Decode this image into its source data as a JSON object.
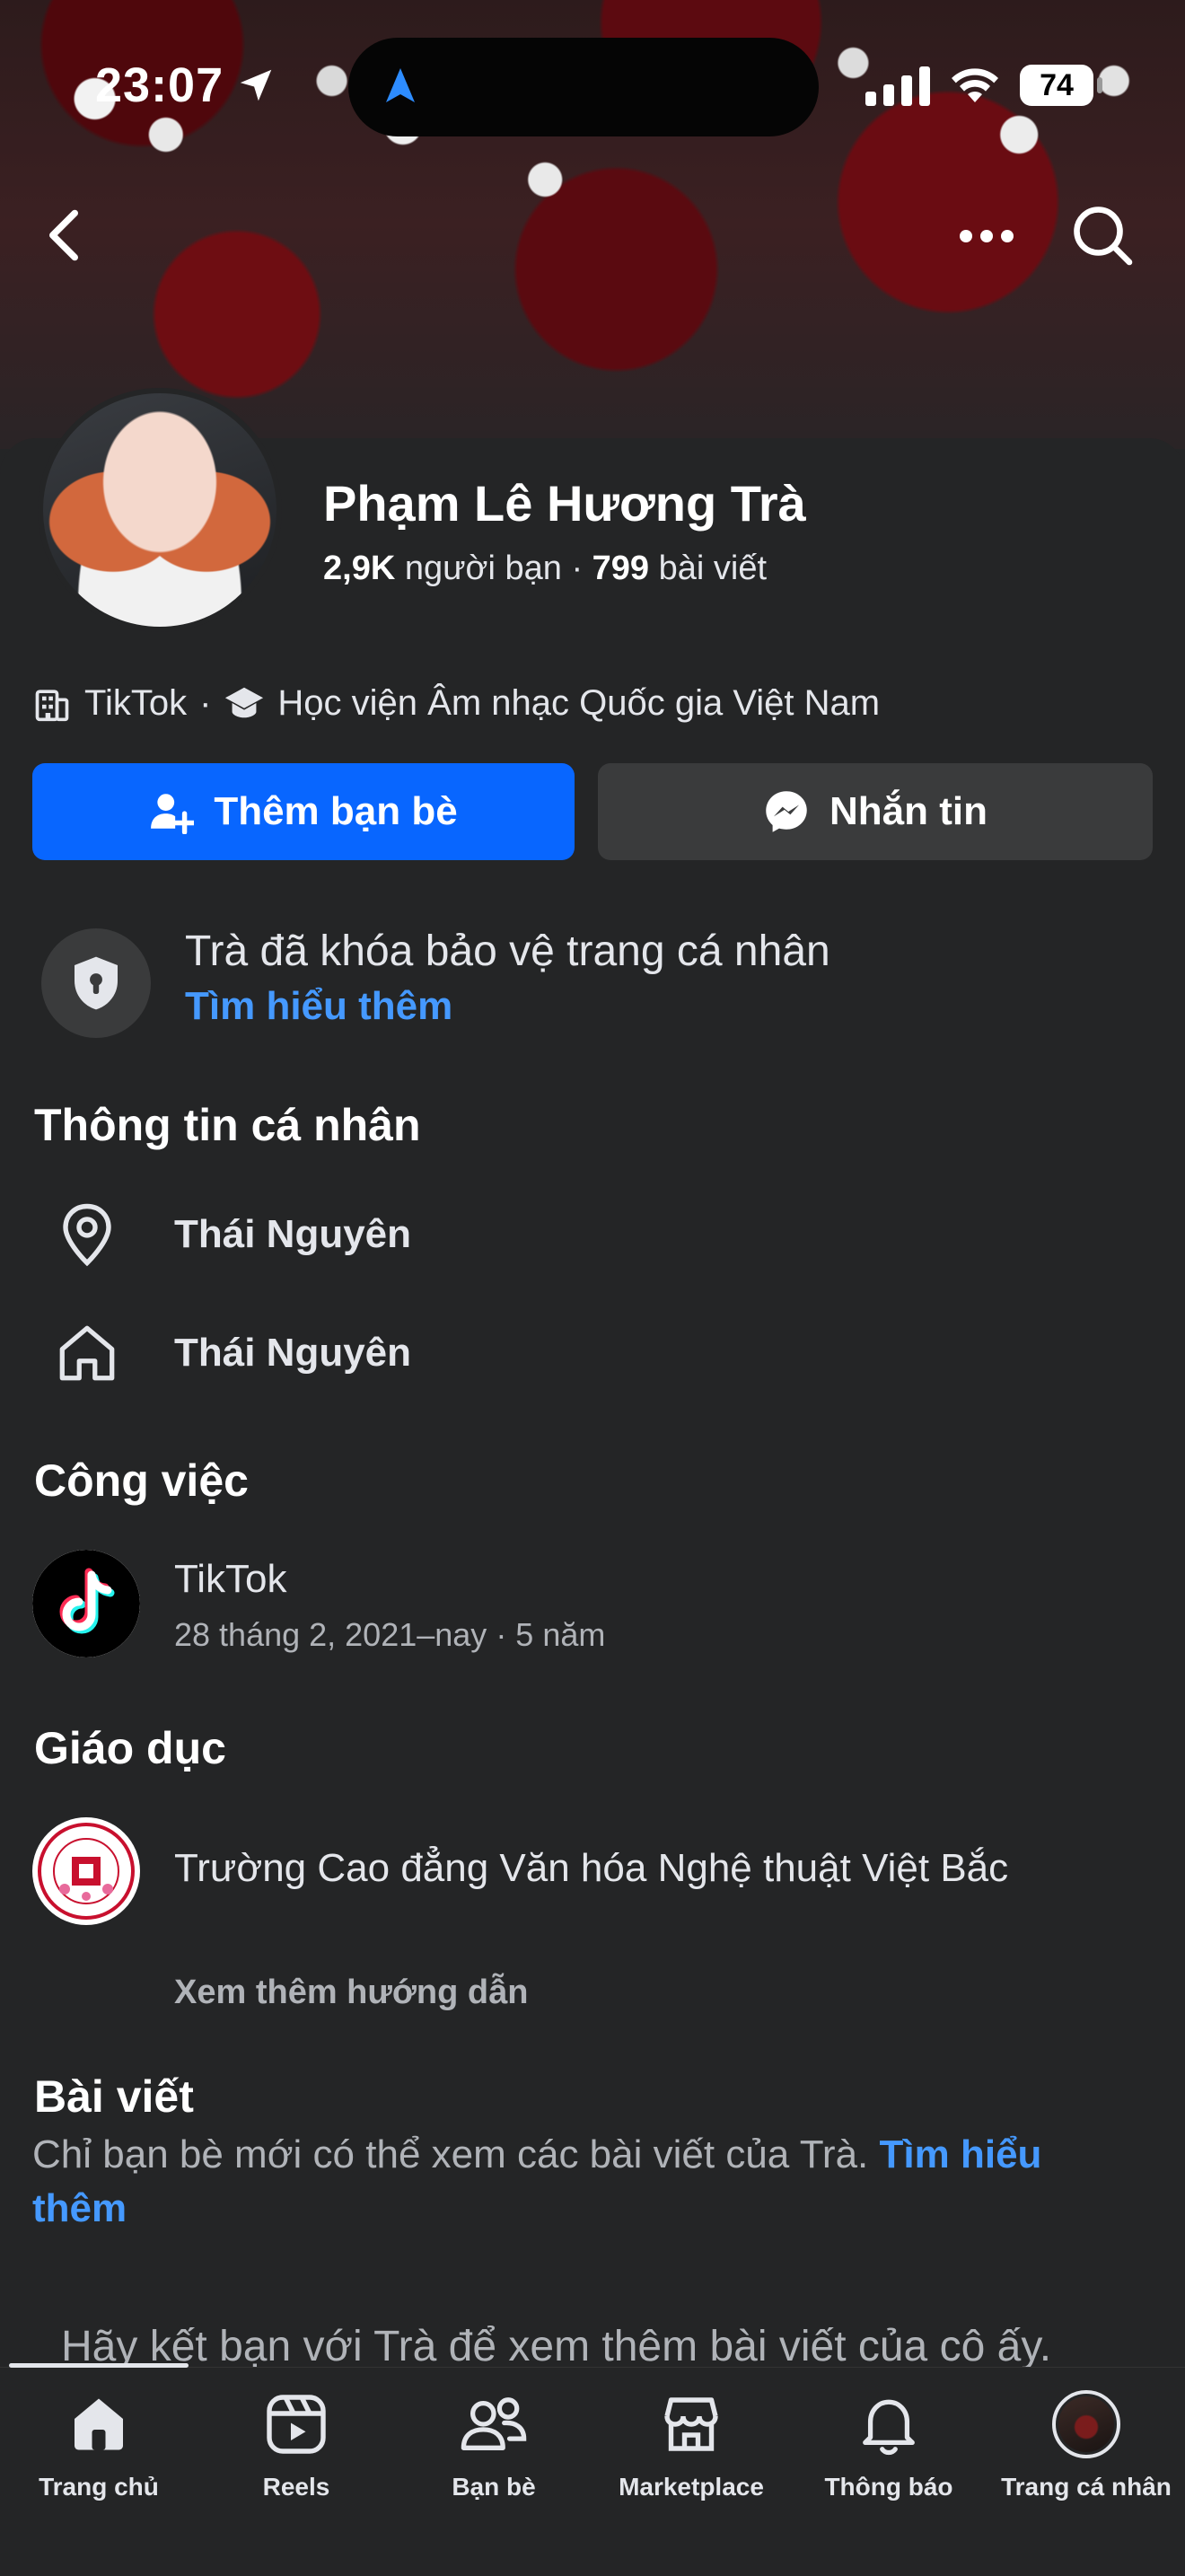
{
  "status_bar": {
    "time": "23:07",
    "battery": "74"
  },
  "profile": {
    "name": "Phạm Lê Hương Trà",
    "friends_count": "2,9K",
    "friends_label": "người bạn",
    "posts_count": "799",
    "posts_label": "bài viết",
    "work_short": "TikTok",
    "school_short": "Học viện Âm nhạc Quốc gia Việt Nam"
  },
  "actions": {
    "add_friend": "Thêm bạn bè",
    "message": "Nhắn tin"
  },
  "lock_notice": {
    "text": "Trà đã khóa bảo vệ trang cá nhân",
    "link": "Tìm hiểu thêm"
  },
  "personal_info": {
    "title": "Thông tin cá nhân",
    "current_city": "Thái Nguyên",
    "hometown": "Thái Nguyên"
  },
  "work": {
    "title": "Công việc",
    "company": "TikTok",
    "period": "28 tháng 2, 2021–nay · 5 năm"
  },
  "education": {
    "title": "Giáo dục",
    "school": "Trường Cao đẳng Văn hóa Nghệ thuật Việt Bắc",
    "see_more": "Xem thêm hướng dẫn"
  },
  "posts": {
    "title": "Bài viết",
    "desc": "Chỉ bạn bè mới có thể xem các bài viết của Trà.",
    "link": "Tìm hiểu thêm",
    "hint": "Hãy kết bạn với Trà để xem thêm bài viết của cô ấy."
  },
  "tabs": [
    {
      "label": "Trang chủ",
      "icon": "home-icon"
    },
    {
      "label": "Reels",
      "icon": "reels-icon"
    },
    {
      "label": "Bạn bè",
      "icon": "friends-icon"
    },
    {
      "label": "Marketplace",
      "icon": "marketplace-icon"
    },
    {
      "label": "Thông báo",
      "icon": "bell-icon"
    },
    {
      "label": "Trang cá nhân",
      "icon": "profile-avatar-icon"
    }
  ],
  "colors": {
    "background": "#242526",
    "primary_blue": "#0866ff",
    "link_blue": "#4599ff",
    "secondary_button": "#3a3b3c"
  }
}
